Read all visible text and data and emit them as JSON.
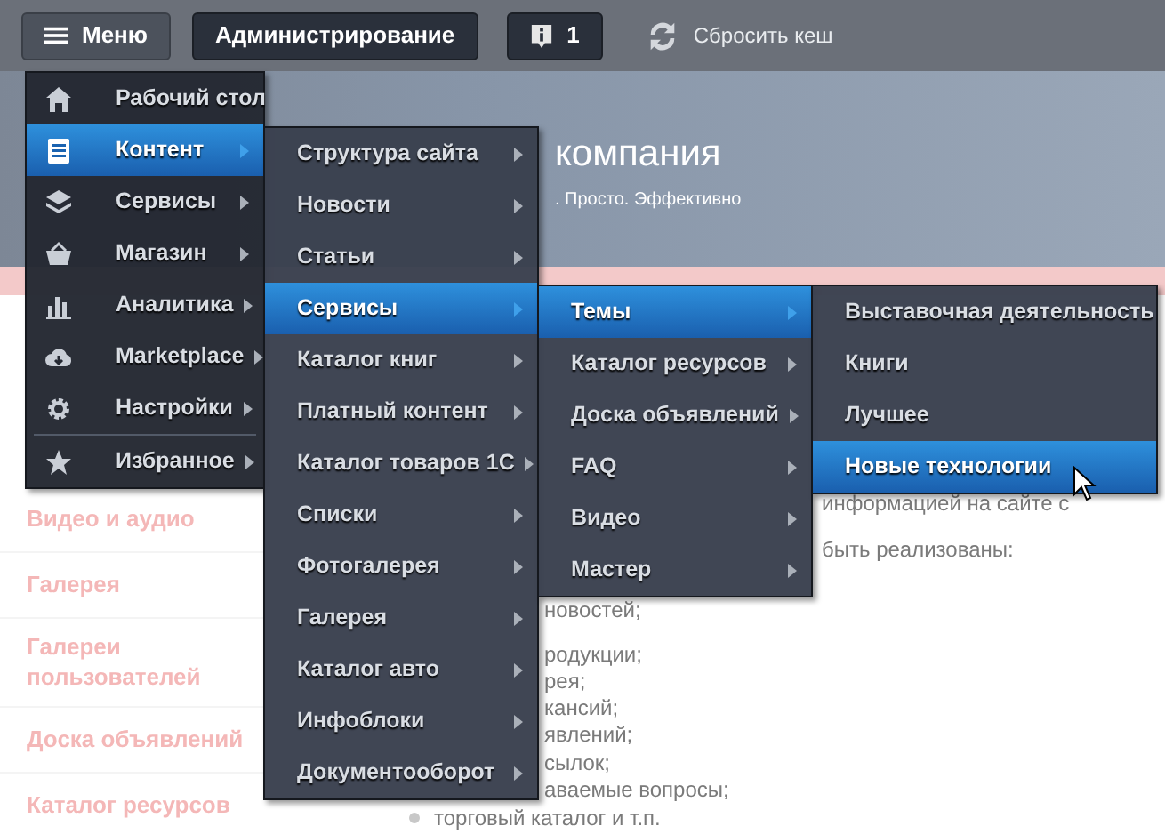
{
  "toolbar": {
    "menu_button": {
      "label": "Меню",
      "selected": true
    },
    "admin_button": {
      "label": "Администрирование"
    },
    "notifications_button": {
      "count": "1"
    },
    "cache_link": {
      "label": "Сбросить кеш"
    }
  },
  "site_header": {
    "title": "компания",
    "tagline": ". Просто. Эффективно"
  },
  "sidebar": {
    "items": [
      "Видео и аудио",
      "Галерея",
      "Галереи пользователей",
      "Доска объявлений",
      "Каталог ресурсов"
    ]
  },
  "content": {
    "paragraph_fragments": [
      "информацией на сайте с",
      "быть реализованы:"
    ],
    "list_fragments": [
      "новостей;",
      "родукции;",
      "рея;",
      "кансий;",
      "явлений;",
      "сылок;",
      "аваемые вопросы;"
    ],
    "last_list_item": "торговый каталог и т.п."
  },
  "menus": [
    {
      "items": [
        {
          "label": "Рабочий стол",
          "selected": false,
          "submenu": false
        },
        {
          "label": "Контент",
          "selected": true,
          "submenu": true
        },
        {
          "label": "Сервисы",
          "selected": false,
          "submenu": true
        },
        {
          "label": "Магазин",
          "selected": false,
          "submenu": true
        },
        {
          "label": "Аналитика",
          "selected": false,
          "submenu": true
        },
        {
          "label": "Marketplace",
          "selected": false,
          "submenu": true
        },
        {
          "label": "Настройки",
          "selected": false,
          "submenu": true
        },
        {
          "label": "Избранное",
          "selected": false,
          "submenu": true
        }
      ]
    },
    {
      "items": [
        {
          "label": "Структура сайта",
          "selected": false,
          "submenu": true
        },
        {
          "label": "Новости",
          "selected": false,
          "submenu": true
        },
        {
          "label": "Статьи",
          "selected": false,
          "submenu": true
        },
        {
          "label": "Сервисы",
          "selected": true,
          "submenu": true
        },
        {
          "label": "Каталог книг",
          "selected": false,
          "submenu": true
        },
        {
          "label": "Платный контент",
          "selected": false,
          "submenu": true
        },
        {
          "label": "Каталог товаров 1С",
          "selected": false,
          "submenu": true
        },
        {
          "label": "Списки",
          "selected": false,
          "submenu": true
        },
        {
          "label": "Фотогалерея",
          "selected": false,
          "submenu": true
        },
        {
          "label": "Галерея",
          "selected": false,
          "submenu": true
        },
        {
          "label": "Каталог авто",
          "selected": false,
          "submenu": true
        },
        {
          "label": "Инфоблоки",
          "selected": false,
          "submenu": true
        },
        {
          "label": "Документооборот",
          "selected": false,
          "submenu": true
        }
      ]
    },
    {
      "items": [
        {
          "label": "Темы",
          "selected": true,
          "submenu": true
        },
        {
          "label": "Каталог ресурсов",
          "selected": false,
          "submenu": true
        },
        {
          "label": "Доска объявлений",
          "selected": false,
          "submenu": true
        },
        {
          "label": "FAQ",
          "selected": false,
          "submenu": true
        },
        {
          "label": "Видео",
          "selected": false,
          "submenu": true
        },
        {
          "label": "Мастер",
          "selected": false,
          "submenu": true
        }
      ]
    },
    {
      "items": [
        {
          "label": "Выставочная деятельность",
          "selected": false,
          "submenu": false
        },
        {
          "label": "Книги",
          "selected": false,
          "submenu": false
        },
        {
          "label": "Лучшее",
          "selected": false,
          "submenu": false
        },
        {
          "label": "Новые технологии",
          "selected": true,
          "submenu": false
        }
      ]
    }
  ]
}
